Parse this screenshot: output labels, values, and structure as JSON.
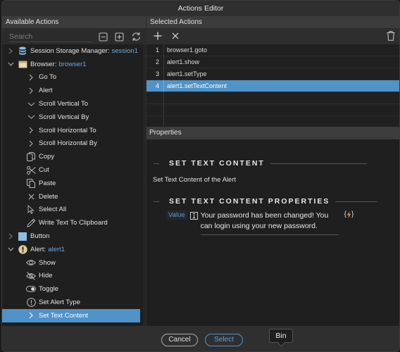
{
  "window": {
    "title": "Actions Editor"
  },
  "available_actions": {
    "header": "Available Actions",
    "search_placeholder": "Search",
    "tree": [
      {
        "label": "Session Storage Manager:",
        "link": "session1",
        "icon": "database-icon",
        "expanded": false,
        "level": 0
      },
      {
        "label": "Browser:",
        "link": "browser1",
        "icon": "browser-window-icon",
        "expanded": true,
        "level": 0
      },
      {
        "label": "Go To",
        "icon": "chevron-right-icon",
        "level": 1
      },
      {
        "label": "Alert",
        "icon": "chevron-right-icon",
        "level": 1
      },
      {
        "label": "Scroll Vertical To",
        "icon": "chevron-down-icon",
        "level": 1
      },
      {
        "label": "Scroll Vertical By",
        "icon": "chevron-down-icon",
        "level": 1
      },
      {
        "label": "Scroll Horizontal To",
        "icon": "chevron-right-icon",
        "level": 1
      },
      {
        "label": "Scroll Horizontal By",
        "icon": "chevron-right-icon",
        "level": 1
      },
      {
        "label": "Copy",
        "icon": "copy-icon",
        "level": 1
      },
      {
        "label": "Cut",
        "icon": "scissors-icon",
        "level": 1
      },
      {
        "label": "Paste",
        "icon": "paste-icon",
        "level": 1
      },
      {
        "label": "Delete",
        "icon": "x-icon",
        "level": 1
      },
      {
        "label": "Select All",
        "icon": "cursor-icon",
        "level": 1
      },
      {
        "label": "Write Text To Clipboard",
        "icon": "pencil-icon",
        "level": 1
      },
      {
        "label": "Button",
        "icon": "button-square-icon",
        "expanded": false,
        "level": 0
      },
      {
        "label": "Alert:",
        "link": "alert1",
        "icon": "alert-exclamation-icon",
        "expanded": true,
        "level": 0
      },
      {
        "label": "Show",
        "icon": "eye-icon",
        "level": 1
      },
      {
        "label": "Hide",
        "icon": "eye-slash-icon",
        "level": 1
      },
      {
        "label": "Toggle",
        "icon": "toggle-icon",
        "level": 1
      },
      {
        "label": "Set Alert Type",
        "icon": "exclamation-circle-icon",
        "level": 1
      },
      {
        "label": "Set Text Content",
        "icon": "chevron-right-icon",
        "level": 1,
        "selected": true
      }
    ]
  },
  "selected_actions": {
    "header": "Selected Actions",
    "rows": [
      {
        "num": "1",
        "value": "browser1.goto"
      },
      {
        "num": "2",
        "value": "alert1.show"
      },
      {
        "num": "3",
        "value": "alert1.setType"
      },
      {
        "num": "4",
        "value": "alert1.setTextContent",
        "selected": true
      },
      {
        "num": "",
        "value": ""
      },
      {
        "num": "",
        "value": ""
      },
      {
        "num": "",
        "value": ""
      }
    ]
  },
  "properties": {
    "header": "Properties",
    "section_title": "SET TEXT CONTENT",
    "description": "Set Text Content of the Alert",
    "props_title": "SET TEXT CONTENT PROPERTIES",
    "value_label": "Value",
    "value_text": "Your password has been changed! You can login using your new password."
  },
  "footer": {
    "cancel_label": "Cancel",
    "select_label": "Select",
    "tooltip": "Bin"
  },
  "colors": {
    "accent": "#4f93c8",
    "link": "#6aa9e0",
    "bind_icon": "#e8916a"
  }
}
